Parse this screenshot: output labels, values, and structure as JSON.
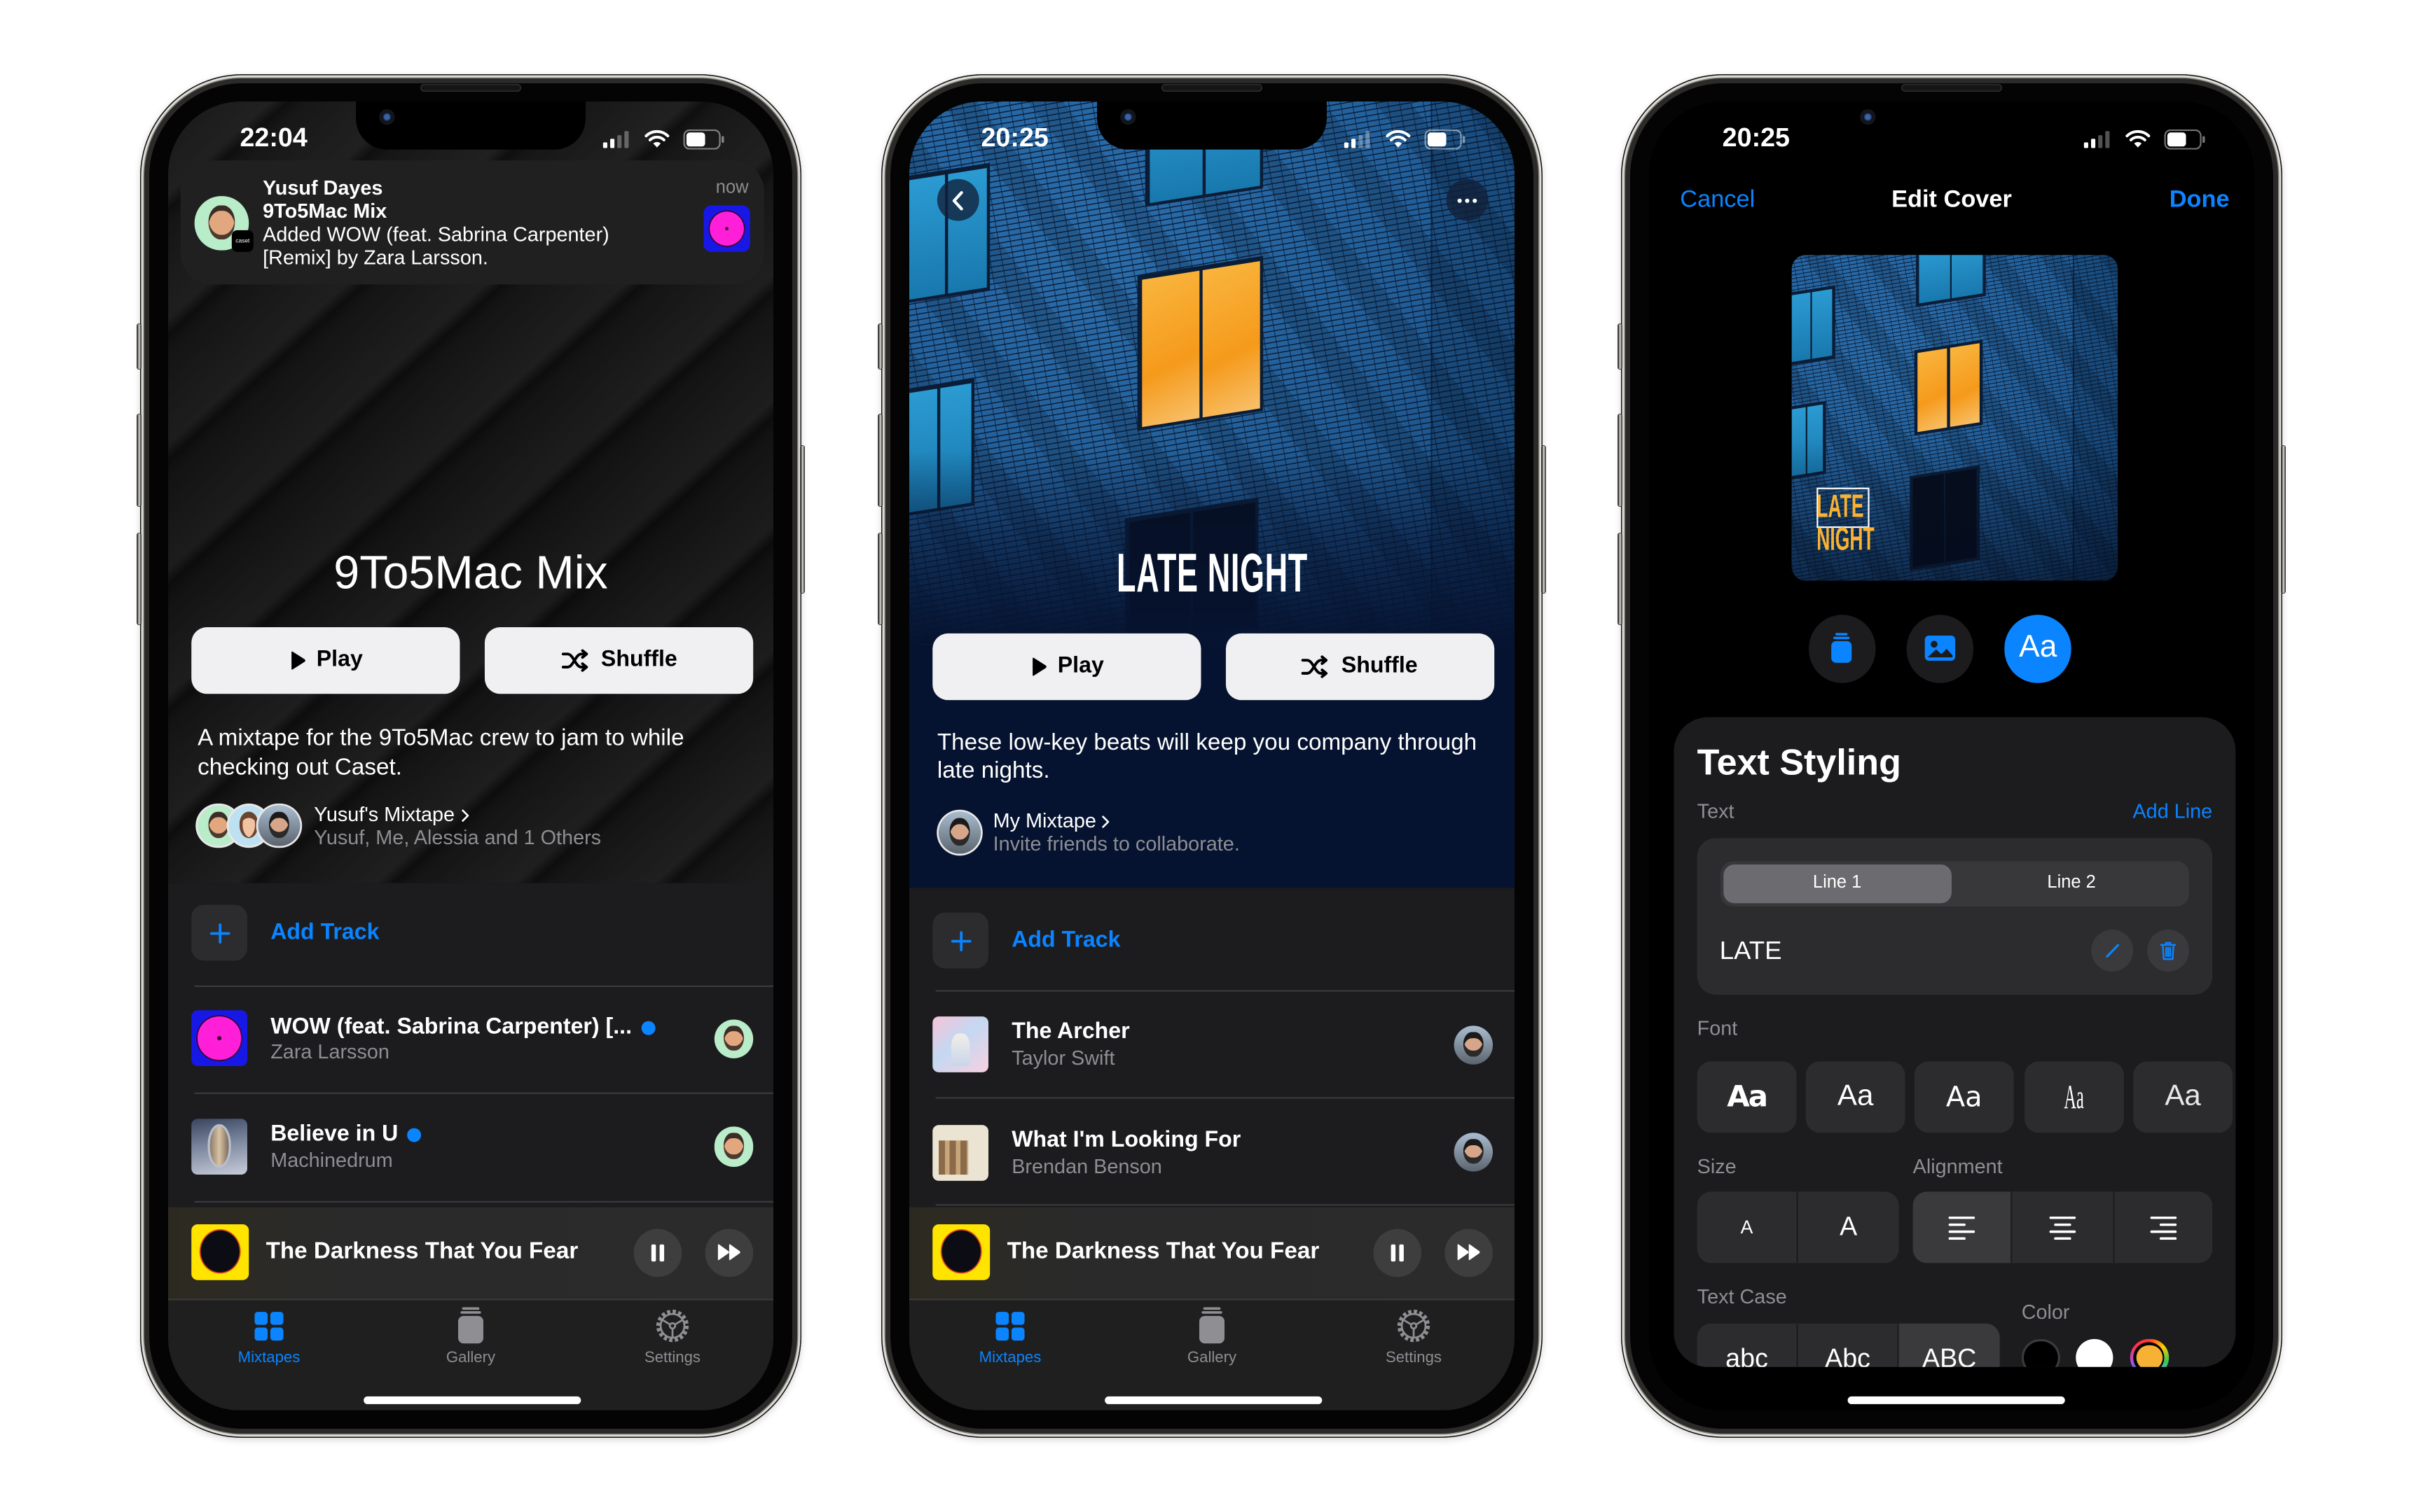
{
  "screens": {
    "mixtape": {
      "status": {
        "time": "22:04",
        "signal_bars": 2,
        "battery_level": 0.6
      },
      "notification": {
        "sender": "Yusuf Dayes",
        "title": "9To5Mac Mix",
        "body": "Added WOW (feat. Sabrina Carpenter) [Remix] by Zara Larsson.",
        "time": "now",
        "app_badge": "caset"
      },
      "title": "9To5Mac Mix",
      "actions": {
        "play": "Play",
        "shuffle": "Shuffle"
      },
      "description": "A mixtape for the 9To5Mac crew to jam to while checking out Caset.",
      "owner": {
        "title": "Yusuf's Mixtape",
        "subtitle": "Yusuf, Me, Alessia and 1 Others"
      },
      "add_track": "Add Track",
      "tracks": [
        {
          "title": "WOW (feat. Sabrina Carpenter) [...",
          "artist": "Zara Larsson",
          "new_indicator": true
        },
        {
          "title": "Believe in U",
          "artist": "Machinedrum",
          "new_indicator": true
        }
      ],
      "now_playing": {
        "title": "The Darkness That You Fear"
      },
      "tabs": [
        {
          "label": "Mixtapes",
          "active": true
        },
        {
          "label": "Gallery",
          "active": false
        },
        {
          "label": "Settings",
          "active": false
        }
      ]
    },
    "late_night": {
      "status": {
        "time": "20:25",
        "signal_bars": 2,
        "battery_level": 0.6
      },
      "title": "LATE NIGHT",
      "actions": {
        "play": "Play",
        "shuffle": "Shuffle"
      },
      "description": "These low-key beats will keep you company through late nights.",
      "owner": {
        "title": "My Mixtape",
        "subtitle": "Invite friends to collaborate."
      },
      "add_track": "Add Track",
      "tracks": [
        {
          "title": "The Archer",
          "artist": "Taylor Swift"
        },
        {
          "title": "What I'm Looking For",
          "artist": "Brendan Benson"
        }
      ],
      "now_playing": {
        "title": "The Darkness That You Fear"
      },
      "tabs": [
        {
          "label": "Mixtapes",
          "active": true
        },
        {
          "label": "Gallery",
          "active": false
        },
        {
          "label": "Settings",
          "active": false
        }
      ]
    },
    "edit_cover": {
      "status": {
        "time": "20:25",
        "signal_bars": 2,
        "battery_level": 0.6
      },
      "nav": {
        "cancel": "Cancel",
        "title": "Edit Cover",
        "done": "Done"
      },
      "cover_text": [
        "LATE",
        "NIGHT"
      ],
      "tools": [
        {
          "icon": "stack",
          "active": false
        },
        {
          "icon": "photo",
          "active": false
        },
        {
          "label": "Aa",
          "active": true
        }
      ],
      "panel": {
        "title": "Text Styling",
        "text_label": "Text",
        "add_line": "Add Line",
        "lines": [
          "Line 1",
          "Line 2"
        ],
        "selected_line": 0,
        "line_value": "LATE",
        "font_label": "Font",
        "font_samples": [
          "Aa",
          "Aa",
          "Aa",
          "Aa",
          "Aa"
        ],
        "size_label": "Size",
        "size_options": [
          "A",
          "A"
        ],
        "alignment_label": "Alignment",
        "alignment_options": [
          "left",
          "center",
          "right"
        ],
        "selected_alignment": 0,
        "text_case_label": "Text Case",
        "text_case_options": [
          "abc",
          "Abc",
          "ABC"
        ],
        "selected_text_case": 2,
        "color_label": "Color",
        "colors": [
          "#000000",
          "#ffffff",
          "#f7b135"
        ],
        "selected_color": 2
      }
    }
  },
  "theme": {
    "accent": "#0a84ff",
    "cover_text": "#f9b233",
    "list_background": "#1c1c1e"
  }
}
